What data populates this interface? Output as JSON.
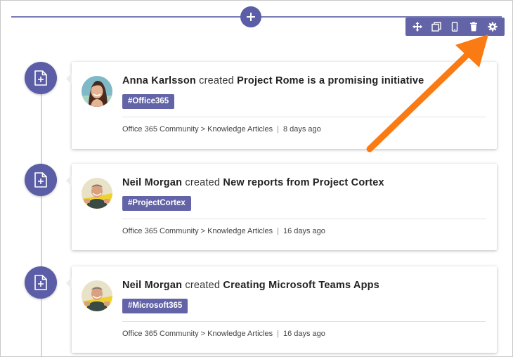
{
  "toolbar": {
    "icons": [
      "move-icon",
      "duplicate-icon",
      "mobile-preview-icon",
      "delete-icon",
      "settings-icon"
    ]
  },
  "annotation_color": "#fa7a14",
  "accent_color": "#6264a7",
  "items": [
    {
      "author": "Anna Karlsson",
      "verb": "created",
      "title": "Project Rome is a promising initiative",
      "tag": "#Office365",
      "source": "Office 365 Community > Knowledge Articles",
      "separator": "|",
      "time": "8 days ago"
    },
    {
      "author": "Neil Morgan",
      "verb": "created",
      "title": "New reports from Project Cortex",
      "tag": "#ProjectCortex",
      "source": "Office 365 Community > Knowledge Articles",
      "separator": "|",
      "time": "16 days ago"
    },
    {
      "author": "Neil Morgan",
      "verb": "created",
      "title": "Creating Microsoft Teams Apps",
      "tag": "#Microsoft365",
      "source": "Office 365 Community > Knowledge Articles",
      "separator": "|",
      "time": "16 days ago"
    }
  ]
}
